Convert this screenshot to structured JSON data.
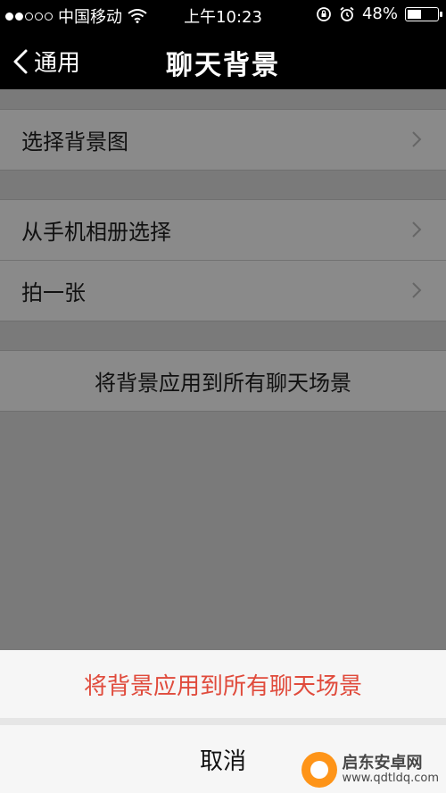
{
  "status_bar": {
    "carrier": "中国移动",
    "time": "上午10:23",
    "battery_percent": "48%",
    "battery_level": 0.48,
    "signal_filled": 2,
    "signal_total": 5
  },
  "nav": {
    "back_label": "通用",
    "title": "聊天背景"
  },
  "list": {
    "group1": [
      {
        "label": "选择背景图"
      }
    ],
    "group2": [
      {
        "label": "从手机相册选择"
      },
      {
        "label": "拍一张"
      }
    ],
    "group3": [
      {
        "label": "将背景应用到所有聊天场景"
      }
    ]
  },
  "sheet": {
    "action_label": "将背景应用到所有聊天场景",
    "cancel_label": "取消"
  },
  "watermark": {
    "title": "启东安卓网",
    "url": "www.qdtldq.com"
  },
  "colors": {
    "destructive": "#e04b3c",
    "nav_bg": "#000000"
  }
}
